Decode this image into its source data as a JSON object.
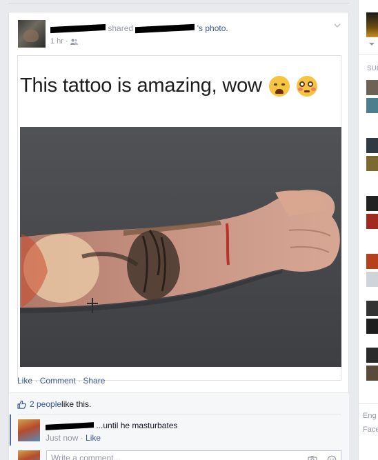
{
  "post": {
    "shared_text": "shared",
    "photo_link": "'s photo.",
    "time": "1 hr",
    "privacy_icon": "friends-icon",
    "caption": "This tattoo is amazing, wow",
    "emojis": [
      "weary-face-emoji",
      "flushed-face-emoji"
    ],
    "actions": {
      "like": "Like",
      "comment": "Comment",
      "share": "Share",
      "separator": " · "
    }
  },
  "ufi": {
    "likes_text": "2 people",
    "likes_suffix": " like this.",
    "comment": {
      "text": "...until he masturbates",
      "time": "Just now",
      "like": "Like"
    },
    "write_placeholder": "Write a comment..."
  },
  "right_column": {
    "section_label": "SUG",
    "footer_line1": "Eng",
    "footer_line2": "Face"
  },
  "colors": {
    "link": "#3b5998",
    "meta": "#9197a3",
    "background": "#e9eaed"
  }
}
